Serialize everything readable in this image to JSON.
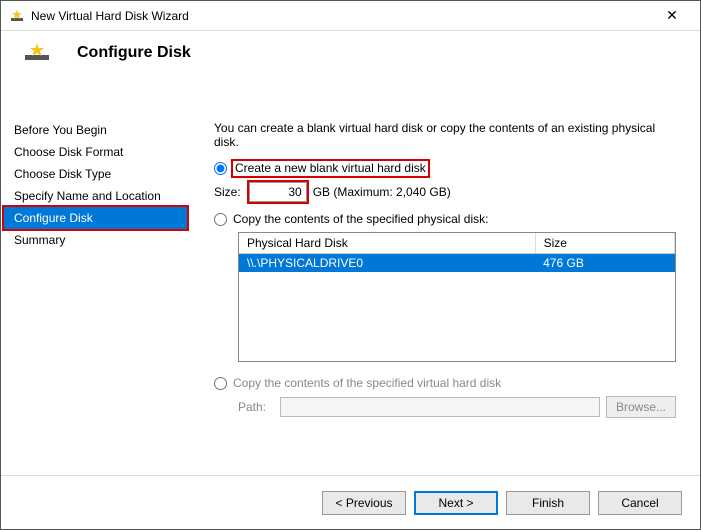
{
  "window": {
    "title": "New Virtual Hard Disk Wizard"
  },
  "header": {
    "title": "Configure Disk"
  },
  "sidebar": {
    "steps": [
      "Before You Begin",
      "Choose Disk Format",
      "Choose Disk Type",
      "Specify Name and Location",
      "Configure Disk",
      "Summary"
    ]
  },
  "main": {
    "description": "You can create a blank virtual hard disk or copy the contents of an existing physical disk.",
    "opt_blank": "Create a new blank virtual hard disk",
    "size_label": "Size:",
    "size_value": "30",
    "size_unit": "GB (Maximum: 2,040 GB)",
    "opt_phys": "Copy the contents of the specified physical disk:",
    "table": {
      "col_disk": "Physical Hard Disk",
      "col_size": "Size",
      "rows": [
        {
          "disk": "\\\\.\\PHYSICALDRIVE0",
          "size": "476 GB"
        }
      ]
    },
    "opt_virt": "Copy the contents of the specified virtual hard disk",
    "path_label": "Path:",
    "path_value": "",
    "browse": "Browse..."
  },
  "footer": {
    "prev": "< Previous",
    "next": "Next >",
    "finish": "Finish",
    "cancel": "Cancel"
  }
}
